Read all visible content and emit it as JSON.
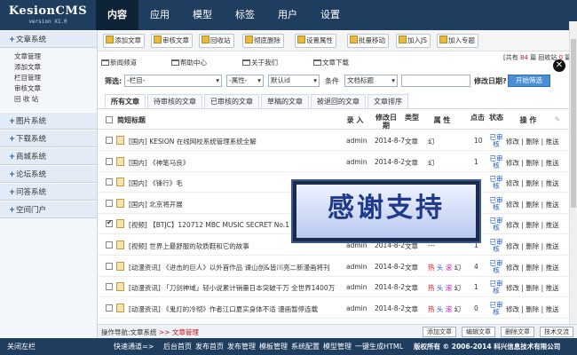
{
  "logo": {
    "title": "KesionCMS",
    "version": "version X1.0"
  },
  "nav": [
    "内容",
    "应用",
    "模型",
    "标签",
    "用户",
    "设置"
  ],
  "sidebar": {
    "sections": [
      "文章系统",
      "图片系统",
      "下载系统",
      "商城系统",
      "论坛系统",
      "问答系统",
      "空间门户"
    ],
    "article_items": [
      "文章管理",
      "添加文章",
      "栏目管理",
      "审核文章",
      "回 收 站"
    ]
  },
  "toolbar": [
    "添加文章",
    "审核文章",
    "回收站",
    "彻底删除",
    "设置属性",
    "批量移动",
    "加入JS",
    "加入专题"
  ],
  "stats": {
    "prefix": "[共有",
    "count": "84",
    "mid": "篇 回收站",
    "recycle": "0",
    "suffix": "篇]"
  },
  "channels": [
    "新闻频道",
    "帮助中心",
    "关于我们",
    "文章下载"
  ],
  "filter": {
    "label": "筛选:",
    "column": "-栏目-",
    "attr": "-属性-",
    "sort": "默认id",
    "cond_label": "条件",
    "cond": "文档标题",
    "date_label": "修改日期?",
    "submit": "开始筛选"
  },
  "tabs": [
    "所有文章",
    "待审核的文章",
    "已审核的文章",
    "草稿的文章",
    "被退回的文章",
    "文章排序"
  ],
  "table": {
    "headers": {
      "title": "简短标题",
      "author": "录 入",
      "date": "修改日期",
      "type": "类型",
      "attr": "属 性",
      "hits": "点击",
      "status": "状态",
      "ops": "操 作"
    },
    "rows": [
      {
        "title": "[国内] KESION 在线网校系统管理系统全解",
        "author": "admin",
        "date": "2014-8-7",
        "type": "文章",
        "attr": "幻",
        "hits": "10",
        "status": "已审核",
        "checked": false
      },
      {
        "title": "[国内] 《神笔马良》",
        "author": "admin",
        "date": "2014-8-2",
        "type": "文章",
        "attr": "幻",
        "hits": "1",
        "status": "已审核",
        "checked": false
      },
      {
        "title": "[国内] 《锋行》毛",
        "author": "admin",
        "date": "2014-8-2",
        "type": "文章",
        "attr": "幻",
        "hits": "0",
        "status": "已审核",
        "checked": false
      },
      {
        "title": "[国内] 北京将开展",
        "author": "admin",
        "date": "2014-8-2",
        "type": "文章",
        "attr": "---",
        "hits": "0",
        "status": "已审核",
        "checked": false
      },
      {
        "title": "[视频] 【BTJC】120712 MBC MUSIC SECRET No.1 冰山公主 Jess",
        "author": "admin",
        "date": "2014-8-2",
        "type": "文章",
        "attr": "幻",
        "hits": "2",
        "status": "已审核",
        "checked": true
      },
      {
        "title": "[视频] 世界上最舒服的软质鞋和它的故事",
        "author": "admin",
        "date": "2014-8-2",
        "type": "文章",
        "attr": "---",
        "hits": "1",
        "status": "已审核",
        "checked": false
      },
      {
        "title": "[动漫资讯] 《进击的巨人》以外首作品 谏山创&皆川亮二新漫画将刊",
        "author": "admin",
        "date": "2014-8-2",
        "type": "文章",
        "attr": "热 头 滚 幻",
        "hits": "4",
        "status": "已审核",
        "checked": false
      },
      {
        "title": "[动漫资讯] 「刀剑神域」轻小说累计销量日本突破千万 全世界1400万",
        "author": "admin",
        "date": "2014-8-2",
        "type": "文章",
        "attr": "热 头 滚 幻",
        "hits": "1",
        "status": "已审核",
        "checked": false
      },
      {
        "title": "[动漫资讯] 《鬼灯的冷彻》作者江口夏实身体不适 漫画暂停连载",
        "author": "admin",
        "date": "2014-8-2",
        "type": "文章",
        "attr": "热 头 滚 幻",
        "hits": "0",
        "status": "已审核",
        "checked": false
      }
    ],
    "op_labels": {
      "edit": "修改",
      "del": "删除",
      "push": "推送"
    }
  },
  "overlay": {
    "text": "感谢支持"
  },
  "bottom": {
    "prefix": "操作导航:",
    "path1": "文章系统",
    "sep": ">>",
    "path2": "文章管理",
    "buttons": [
      "添加文章",
      "编辑文章",
      "删除文章",
      "技术交流"
    ]
  },
  "footer": {
    "close": "关闭左栏",
    "quick": "快速通道=>",
    "links": [
      "后台首页",
      "发布首页",
      "发布管理",
      "模板管理",
      "系统配置",
      "模型管理",
      "一键生成HTML"
    ],
    "copyright": "版权所有 © 2006-2014 科兴信息技术有限公司"
  }
}
